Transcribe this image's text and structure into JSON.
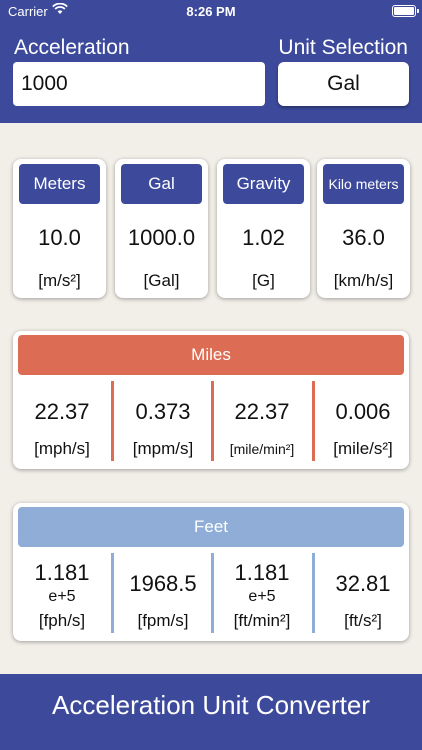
{
  "status_bar": {
    "carrier": "Carrier",
    "time": "8:26 PM"
  },
  "input": {
    "label": "Acceleration",
    "value": "1000"
  },
  "unit_selection": {
    "label": "Unit Selection",
    "value": "Gal"
  },
  "metric_cards": [
    {
      "title": "Meters",
      "value": "10.0",
      "unit": "[m/s²]"
    },
    {
      "title": "Gal",
      "value": "1000.0",
      "unit": "[Gal]"
    },
    {
      "title": "Gravity",
      "value": "1.02",
      "unit": "[G]"
    },
    {
      "title": "Kilo meters",
      "value": "36.0",
      "unit": "[km/h/s]"
    }
  ],
  "miles": {
    "title": "Miles",
    "items": [
      {
        "value": "22.37",
        "unit": "[mph/s]"
      },
      {
        "value": "0.373",
        "unit": "[mpm/s]"
      },
      {
        "value": "22.37",
        "unit": "[mile/min²]"
      },
      {
        "value": "0.006",
        "unit": "[mile/s²]"
      }
    ]
  },
  "feet": {
    "title": "Feet",
    "items": [
      {
        "value": "1.181",
        "exponent": "e+5",
        "unit": "[fph/s]"
      },
      {
        "value": "1968.5",
        "unit": "[fpm/s]"
      },
      {
        "value": "1.181",
        "exponent": "e+5",
        "unit": "[ft/min²]"
      },
      {
        "value": "32.81",
        "unit": "[ft/s²]"
      }
    ]
  },
  "footer": {
    "title": "Acceleration Unit Converter"
  },
  "colors": {
    "primary": "#3d4a9c",
    "miles_accent": "#dc6c53",
    "feet_accent": "#8fadd7",
    "background": "#f2efe9"
  },
  "icons": [
    "wifi-icon",
    "battery-icon"
  ]
}
